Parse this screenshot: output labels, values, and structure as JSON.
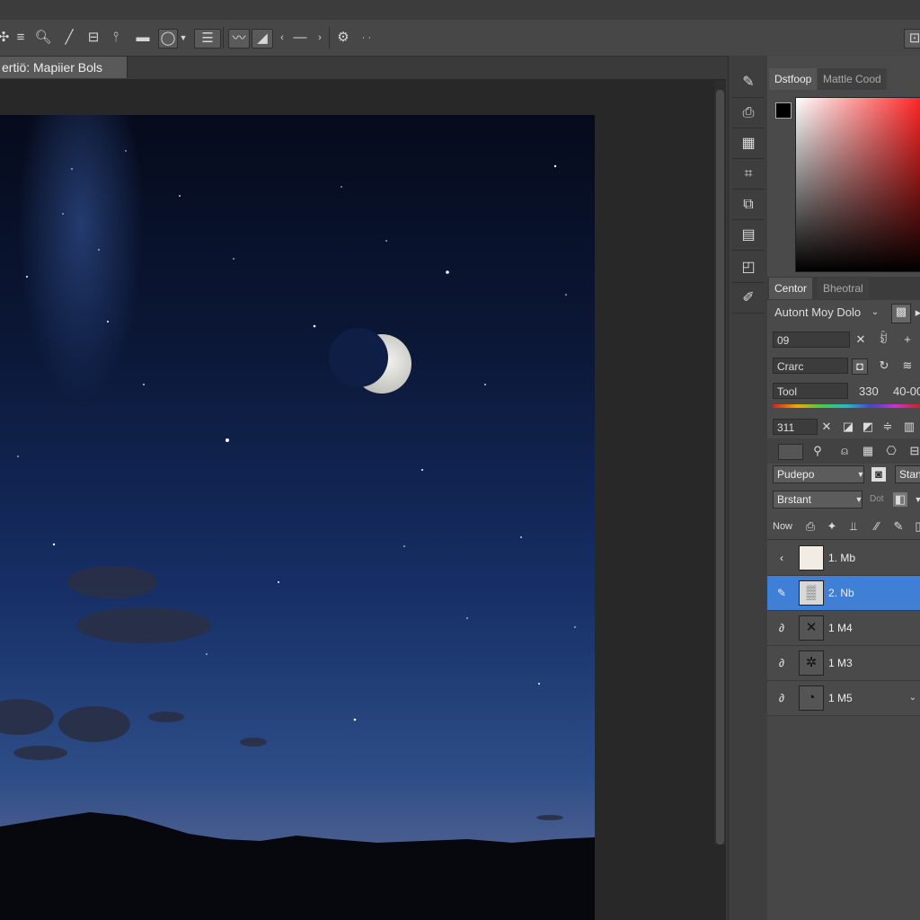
{
  "document": {
    "tab_title": "ertiö: Mapiier Bols"
  },
  "options_bar": {
    "icons": [
      "move-icon",
      "menu-lines-icon",
      "zoom-icon",
      "line-tool-icon",
      "clone-icon",
      "pin-icon",
      "rectangle-icon",
      "lasso-icon",
      "dropdown-arrow-icon",
      "align-icon",
      "brush-icon",
      "gradient-icon",
      "arrow-icon",
      "minus-icon",
      "arrow-right-icon",
      "gear-icon",
      "more-icon"
    ]
  },
  "tool_strip": {
    "tools": [
      "history-icon",
      "stamp-icon",
      "swatch-icon",
      "crop-icon",
      "transform-icon",
      "document-icon",
      "shape-icon",
      "brush-settings-icon"
    ]
  },
  "color_panel": {
    "tabs": [
      "Dstfoop",
      "Mattle Cood"
    ],
    "foreground": "#000000",
    "background": "#ffffff"
  },
  "properties_panel": {
    "tabs": [
      "Centor",
      "Bheotral"
    ],
    "preset_label": "Autont Moy Dolo",
    "field_09": "09",
    "field_crarc": "Crarc",
    "field_tool": "Tool",
    "value_330": "330",
    "value_040": "40-00",
    "field_311": "311",
    "blend_select": "Pudepo",
    "brush_select": "Brstant",
    "side_button": "Stan",
    "mini_label": "Dot",
    "row_label": "Now"
  },
  "layers": [
    {
      "name": "1. Mb",
      "selected": false,
      "thumb": "paper-icon",
      "eye": "chevron-left-icon"
    },
    {
      "name": "2. Nb",
      "selected": true,
      "thumb": "texture-icon",
      "eye": "brush-eye-icon"
    },
    {
      "name": "1 M4",
      "selected": false,
      "thumb": "bird-icon",
      "eye": "link-icon"
    },
    {
      "name": "1 M3",
      "selected": false,
      "thumb": "creature-icon",
      "eye": "link-icon"
    },
    {
      "name": "1 M5",
      "selected": false,
      "thumb": "curve-icon",
      "eye": "link-icon"
    }
  ],
  "colors": {
    "accent": "#3f7fd6",
    "panel_bg": "#4a4a4a",
    "canvas_bg": "#282828"
  }
}
